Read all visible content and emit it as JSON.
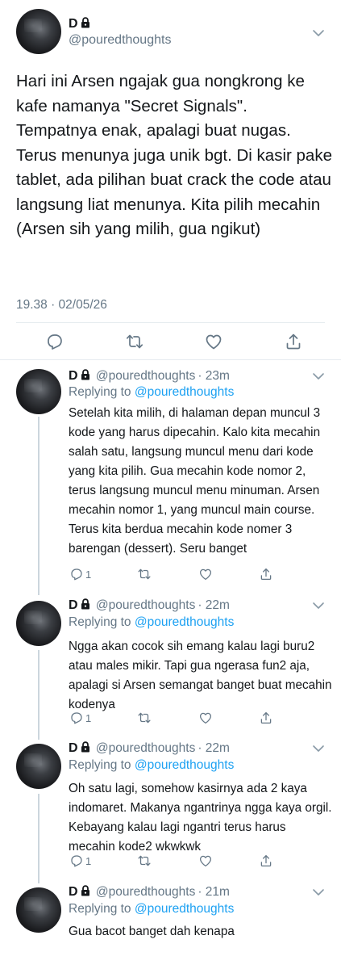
{
  "main_tweet": {
    "display_name": "D",
    "handle": "@pouredthoughts",
    "text": "Hari ini Arsen ngajak gua nongkrong ke kafe namanya \"Secret Signals\". Tempatnya enak, apalagi buat nugas. Terus menunya juga unik bgt. Di kasir pake tablet, ada pilihan buat crack the code atau langsung liat menunya. Kita pilih mecahin (Arsen sih yang milih, gua ngikut)",
    "timestamp": "19.38 · 02/05/26"
  },
  "replies": [
    {
      "display_name": "D",
      "handle": "@pouredthoughts",
      "time": "· 23m",
      "replying_prefix": "Replying to",
      "replying_to": "@pouredthoughts",
      "text": "Setelah kita milih, di halaman depan muncul 3 kode yang harus dipecahin. Kalo kita mecahin salah satu, langsung muncul menu dari kode yang kita pilih. Gua mecahin kode nomor 2, terus langsung muncul menu minuman. Arsen mecahin nomor 1, yang muncul main course. Terus kita berdua mecahin kode nomer 3 barengan (dessert). Seru banget",
      "reply_count": "1"
    },
    {
      "display_name": "D",
      "handle": "@pouredthoughts",
      "time": "· 22m",
      "replying_prefix": "Replying to",
      "replying_to": "@pouredthoughts",
      "text": "Ngga akan cocok sih emang kalau lagi buru2 atau males mikir. Tapi gua ngerasa fun2 aja, apalagi si Arsen semangat banget buat mecahin kodenya",
      "reply_count": "1"
    },
    {
      "display_name": "D",
      "handle": "@pouredthoughts",
      "time": "· 22m",
      "replying_prefix": "Replying to",
      "replying_to": "@pouredthoughts",
      "text": "Oh satu lagi, somehow kasirnya ada 2 kaya indomaret. Makanya ngantrinya ngga kaya orgil. Kebayang kalau lagi ngantri terus harus mecahin kode2 wkwkwk",
      "reply_count": "1"
    },
    {
      "display_name": "D",
      "handle": "@pouredthoughts",
      "time": "· 21m",
      "replying_prefix": "Replying to",
      "replying_to": "@pouredthoughts",
      "text": "Gua bacot banget dah kenapa",
      "reply_count": ""
    }
  ],
  "icons": {
    "reply": "reply-icon",
    "retweet": "retweet-icon",
    "like": "heart-icon",
    "share": "share-icon",
    "lock": "lock-icon",
    "menu": "chevron-down-icon"
  },
  "colors": {
    "text": "#14171a",
    "muted": "#657786",
    "link": "#1da1f2",
    "divider": "#e6ecf0",
    "thread_line": "#ccd6dd"
  }
}
